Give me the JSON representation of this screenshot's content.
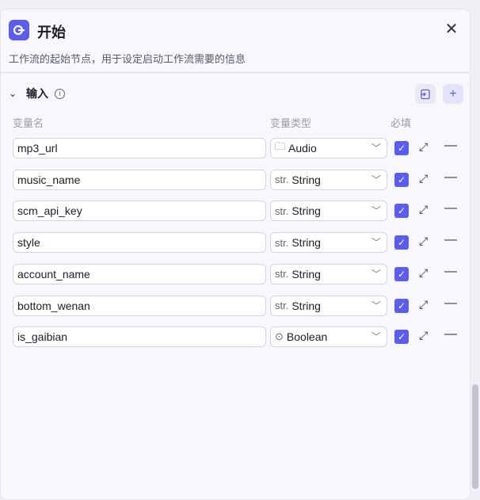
{
  "header": {
    "title": "开始",
    "description": "工作流的起始节点，用于设定启动工作流需要的信息"
  },
  "section": {
    "title": "输入"
  },
  "columns": {
    "name": "变量名",
    "type": "变量类型",
    "required": "必填"
  },
  "rows": [
    {
      "name": "mp3_url",
      "type": "Audio",
      "type_icon": "folder-icon",
      "type_prefix": "🗀",
      "required": true
    },
    {
      "name": "music_name",
      "type": "String",
      "type_icon": "string-icon",
      "type_prefix": "str.",
      "required": true
    },
    {
      "name": "scm_api_key",
      "type": "String",
      "type_icon": "string-icon",
      "type_prefix": "str.",
      "required": true
    },
    {
      "name": "style",
      "type": "String",
      "type_icon": "string-icon",
      "type_prefix": "str.",
      "required": true
    },
    {
      "name": "account_name",
      "type": "String",
      "type_icon": "string-icon",
      "type_prefix": "str.",
      "required": true
    },
    {
      "name": "bottom_wenan",
      "type": "String",
      "type_icon": "string-icon",
      "type_prefix": "str.",
      "required": true
    },
    {
      "name": "is_gaibian",
      "type": "Boolean",
      "type_icon": "toggle-icon",
      "type_prefix": "⊙",
      "required": true
    }
  ],
  "colors": {
    "accent": "#5b5cf0"
  }
}
